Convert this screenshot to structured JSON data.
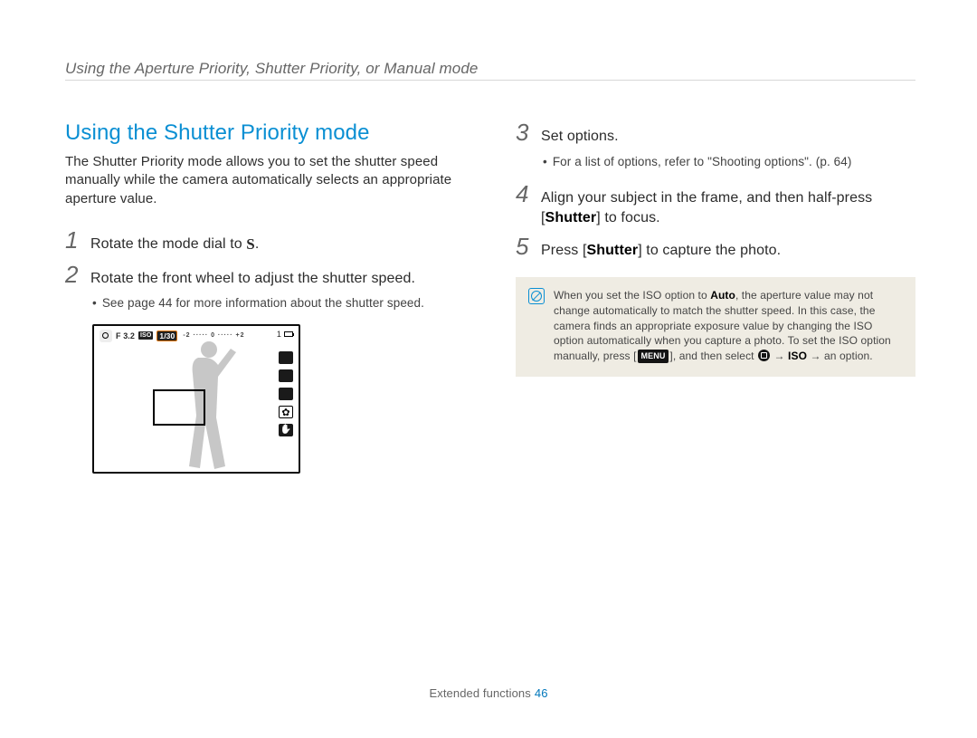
{
  "header": {
    "running": "Using the Aperture Priority, Shutter Priority, or Manual mode"
  },
  "left": {
    "title": "Using the Shutter Priority mode",
    "intro": "The Shutter Priority mode allows you to set the shutter speed manually while the camera automatically selects an appropriate aperture value.",
    "step1_pre": "Rotate the mode dial to ",
    "step1_post": ".",
    "step2": "Rotate the front wheel to adjust the shutter speed.",
    "step2_sub": "See page 44 for more information about the shutter speed."
  },
  "lcd": {
    "f_label": "F 3.2",
    "shutter": "1/30",
    "ev": "-2 ····· 0 ····· +2",
    "count": "1"
  },
  "right": {
    "step3": "Set options.",
    "step3_sub": "For a list of options, refer to \"Shooting options\". (p. 64)",
    "step4_pre": "Align your subject in the frame, and then half-press [",
    "step4_bold": "Shutter",
    "step4_post": "] to focus.",
    "step5_pre": "Press [",
    "step5_bold": "Shutter",
    "step5_post": "] to capture the photo."
  },
  "note": {
    "t1": "When you set the ISO option to ",
    "auto": "Auto",
    "t2": ", the aperture value may not change automatically to match the shutter speed. In this case, the camera finds an appropriate exposure value by changing the ISO option automatically when you capture a photo. To set the ISO option manually, press [",
    "menu": "MENU",
    "t3": "], and then select ",
    "iso": "ISO",
    "t4": " → an option."
  },
  "footer": {
    "section": "Extended functions",
    "page": "46"
  }
}
